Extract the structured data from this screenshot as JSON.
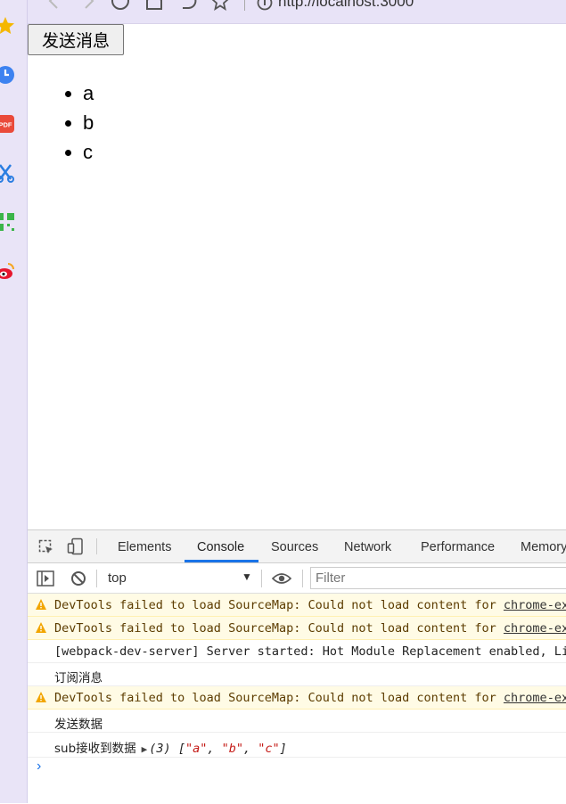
{
  "browser": {
    "url": "http://localhost:3000",
    "toolbar_icons": [
      "back-icon",
      "forward-icon",
      "reload-icon",
      "home-icon",
      "undo-icon",
      "star-icon",
      "info-icon"
    ]
  },
  "sidebar": {
    "icons": [
      "favorites-star-icon",
      "history-clock-icon",
      "pdf-icon",
      "scissors-icon",
      "qr-code-icon",
      "weibo-icon"
    ]
  },
  "page": {
    "send_button": "发送消息",
    "list_items": [
      "a",
      "b",
      "c"
    ]
  },
  "devtools": {
    "tabs": [
      "Elements",
      "Console",
      "Sources",
      "Network",
      "Performance",
      "Memory"
    ],
    "active_tab": "Console",
    "context": "top",
    "filter_placeholder": "Filter",
    "messages": {
      "warn_prefix": "DevTools failed to load SourceMap: Could not load content for ",
      "warn_link": "chrome-extension",
      "webpack": "[webpack-dev-server] Server started: Hot Module Replacement enabled, Live Reloading enabled",
      "subscribe": "订阅消息",
      "send_data": "发送数据",
      "received_label": "sub接收到数据",
      "array_count": "(3)",
      "array_values": [
        "\"a\"",
        "\"b\"",
        "\"c\""
      ]
    },
    "prompt_symbol": "›"
  },
  "colors": {
    "sidebar_bg": "#e9e4f7",
    "accent": "#1a73e8",
    "warning_bg": "#fffbe5",
    "string": "#c41a16"
  }
}
